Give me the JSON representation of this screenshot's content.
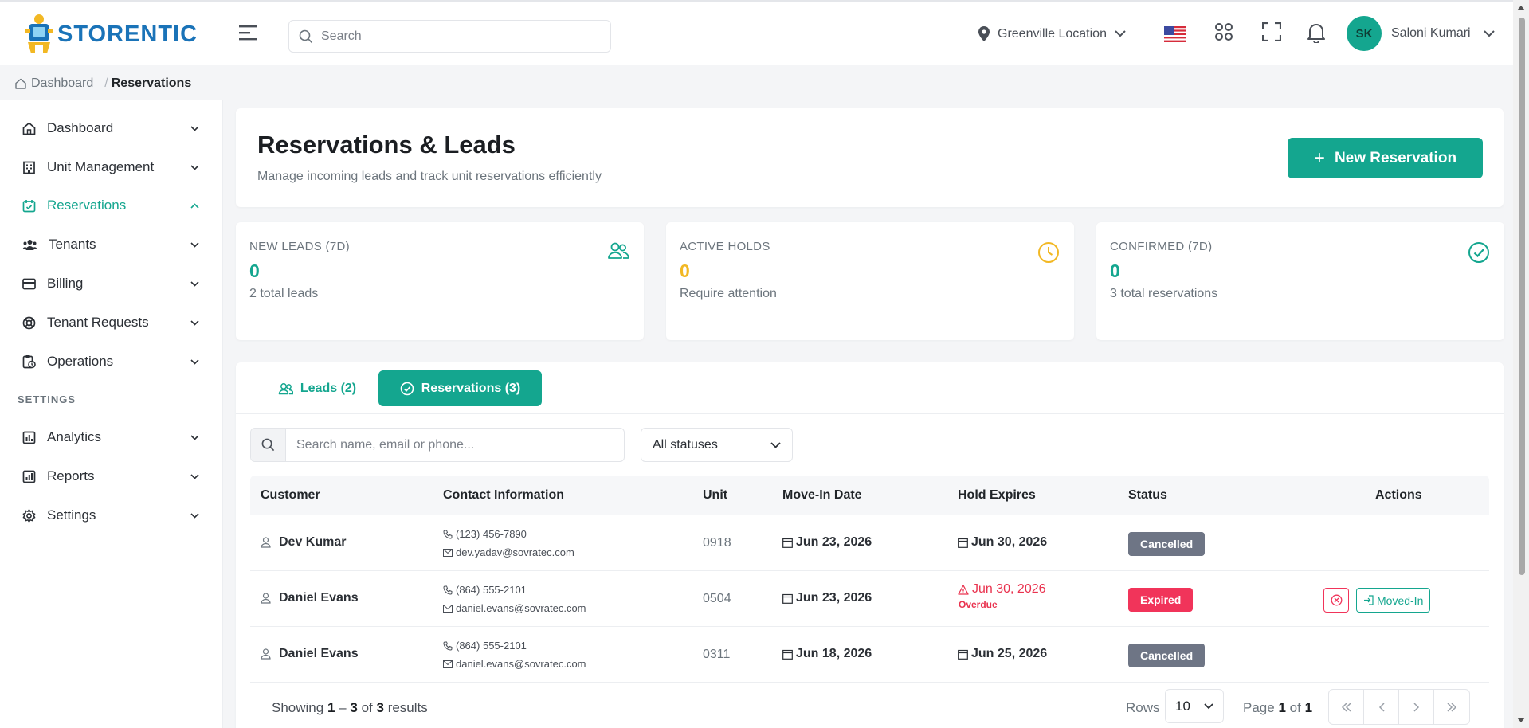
{
  "header": {
    "brand": "STORENTIC",
    "search_placeholder": "Search",
    "location": "Greenville Location",
    "flag_icon": "us-flag-icon",
    "user_initials": "SK",
    "user_name": "Saloni Kumari"
  },
  "breadcrumb": {
    "home": "Dashboard",
    "separator": "/",
    "current": "Reservations"
  },
  "sidebar": {
    "items": [
      {
        "label": "Dashboard",
        "icon": "home-icon"
      },
      {
        "label": "Unit Management",
        "icon": "building-icon"
      },
      {
        "label": "Reservations",
        "icon": "calendar-check-icon",
        "active": true
      },
      {
        "label": "Tenants",
        "icon": "users-icon"
      },
      {
        "label": "Billing",
        "icon": "credit-card-icon"
      },
      {
        "label": "Tenant Requests",
        "icon": "lifebuoy-icon"
      },
      {
        "label": "Operations",
        "icon": "clipboard-clock-icon"
      }
    ],
    "settings_section": "SETTINGS",
    "settings_items": [
      {
        "label": "Analytics",
        "icon": "bar-chart-icon"
      },
      {
        "label": "Reports",
        "icon": "report-icon"
      },
      {
        "label": "Settings",
        "icon": "gear-icon"
      }
    ]
  },
  "page": {
    "title": "Reservations & Leads",
    "subtitle": "Manage incoming leads and track unit reservations efficiently",
    "new_button": "New Reservation"
  },
  "stats": [
    {
      "label": "NEW LEADS (7D)",
      "value": "0",
      "sub": "2 total leads",
      "color": "#14a68f",
      "icon": "users-icon"
    },
    {
      "label": "ACTIVE HOLDS",
      "value": "0",
      "sub": "Require attention",
      "color": "#f2b824",
      "icon": "clock-icon"
    },
    {
      "label": "CONFIRMED (7D)",
      "value": "0",
      "sub": "3 total reservations",
      "color": "#14a68f",
      "icon": "check-circle-icon"
    }
  ],
  "tabs": {
    "leads": "Leads (2)",
    "reservations": "Reservations (3)"
  },
  "filters": {
    "search_placeholder": "Search name, email or phone...",
    "status_selected": "All statuses"
  },
  "table": {
    "columns": [
      "Customer",
      "Contact Information",
      "Unit",
      "Move-In Date",
      "Hold Expires",
      "Status",
      "Actions"
    ],
    "rows": [
      {
        "customer": "Dev Kumar",
        "phone": "(123) 456-7890",
        "email": "dev.yadav@sovratec.com",
        "unit": "0918",
        "move_in": "Jun 23, 2026",
        "hold_expires": "Jun 30, 2026",
        "status": "Cancelled"
      },
      {
        "customer": "Daniel Evans",
        "phone": "(864) 555-2101",
        "email": "daniel.evans@sovratec.com",
        "unit": "0504",
        "move_in": "Jun 23, 2026",
        "hold_expires": "Jun 30, 2026",
        "overdue": "Overdue",
        "status": "Expired",
        "action_moved": "Moved-In"
      },
      {
        "customer": "Daniel Evans",
        "phone": "(864) 555-2101",
        "email": "daniel.evans@sovratec.com",
        "unit": "0311",
        "move_in": "Jun 18, 2026",
        "hold_expires": "Jun 25, 2026",
        "status": "Cancelled"
      }
    ]
  },
  "footer": {
    "showing_prefix": "Showing",
    "range_start": "1",
    "range_dash": "–",
    "range_end": "3",
    "of_word": "of",
    "total": "3",
    "results_word": "results",
    "rows_label": "Rows",
    "rows_value": "10",
    "page_word": "Page",
    "page_current": "1",
    "page_of": "of",
    "page_total": "1"
  },
  "colors": {
    "accent": "#14a68f",
    "warning": "#f2b824",
    "danger": "#f1345a",
    "muted_badge": "#6e7585",
    "brand_blue": "#1a73b8"
  }
}
